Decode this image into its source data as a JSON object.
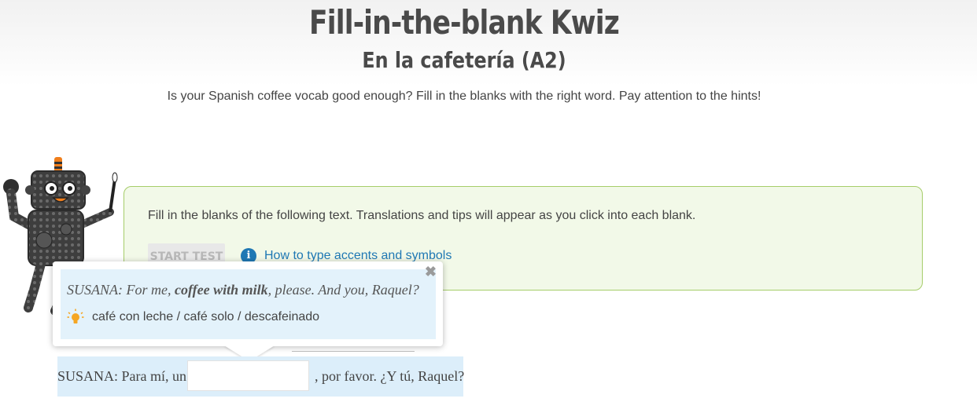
{
  "header": {
    "title": "Fill-in-the-blank Kwiz",
    "subtitle": "En la cafetería (A2)",
    "intro": "Is your Spanish coffee vocab good enough? Fill in the blanks with the right word. Pay attention to the hints!"
  },
  "instructions": {
    "text": "Fill in the blanks of the following text. Translations and tips will appear as you click into each blank.",
    "start_label": "START TEST",
    "accents_link": "How to type accents and symbols",
    "info_icon": "i"
  },
  "tooltip": {
    "speaker": "SUSANA:",
    "line_pre": "For me,",
    "line_bold": "coffee with milk",
    "line_post": ", please. And you, Raquel?",
    "hint": "café con leche / café solo / descafeinado",
    "close_symbol": "✖"
  },
  "exercise": {
    "pre_text": "SUSANA: Para mí, un",
    "blank_value": "",
    "blank_placeholder": "",
    "post_text": ", por favor. ¿Y tú, Raquel?"
  },
  "colors": {
    "accent_blue": "#1f78b4",
    "green_border": "#a6cd6a",
    "green_bg": "#f2f9e8",
    "hint_bg": "#e3f2fb",
    "robot_orange": "#f07e1b"
  }
}
